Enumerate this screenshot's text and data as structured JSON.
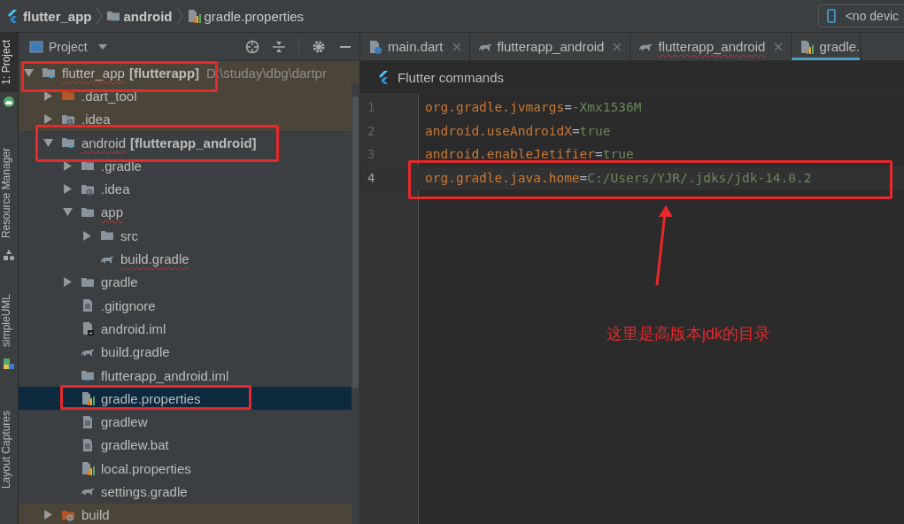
{
  "breadcrumbs": [
    {
      "label": "flutter_app"
    },
    {
      "label": "android"
    },
    {
      "label": "gradle.properties"
    }
  ],
  "device_selector": {
    "label": "<no devic"
  },
  "tool_strip": [
    {
      "label": "1: Project",
      "selected": true
    },
    {
      "label": "Resource Manager",
      "selected": false
    },
    {
      "label": "simpleUML",
      "selected": false
    },
    {
      "label": "Layout Captures",
      "selected": false
    }
  ],
  "project_panel": {
    "title": "Project"
  },
  "tree": [
    {
      "name": "flutter_app",
      "module": "[flutterapp]",
      "path": "D:\\studay\\dbg\\dartpr",
      "kind": "module",
      "expanded": true,
      "typo": true,
      "excluded": true,
      "selected": false,
      "children": [
        {
          "name": ".dart_tool",
          "kind": "orange-folder",
          "expanded": false,
          "typo": false,
          "excluded": true,
          "selected": false
        },
        {
          "name": ".idea",
          "kind": "idea-folder",
          "expanded": false,
          "typo": false,
          "excluded": true,
          "selected": false
        },
        {
          "name": "android",
          "module": "[flutterapp_android]",
          "kind": "module",
          "expanded": true,
          "typo": true,
          "excluded": false,
          "selected": false,
          "children": [
            {
              "name": ".gradle",
              "kind": "folder",
              "expanded": false,
              "typo": false,
              "excluded": false,
              "selected": false
            },
            {
              "name": ".idea",
              "kind": "idea-folder",
              "expanded": false,
              "typo": false,
              "excluded": false,
              "selected": false
            },
            {
              "name": "app",
              "kind": "folder",
              "expanded": true,
              "typo": true,
              "excluded": false,
              "selected": false,
              "children": [
                {
                  "name": "src",
                  "kind": "folder",
                  "expanded": false,
                  "typo": false,
                  "excluded": false,
                  "selected": false
                },
                {
                  "name": "build.gradle",
                  "kind": "gradle",
                  "typo": true,
                  "excluded": false,
                  "selected": false
                }
              ]
            },
            {
              "name": "gradle",
              "kind": "folder",
              "expanded": false,
              "typo": false,
              "excluded": false,
              "selected": false
            },
            {
              "name": ".gitignore",
              "kind": "text",
              "typo": false,
              "excluded": false,
              "selected": false
            },
            {
              "name": "android.iml",
              "kind": "iml",
              "typo": false,
              "excluded": false,
              "selected": false
            },
            {
              "name": "build.gradle",
              "kind": "gradle",
              "typo": false,
              "excluded": false,
              "selected": false
            },
            {
              "name": "flutterapp_android.iml",
              "kind": "module-file",
              "typo": false,
              "excluded": false,
              "selected": false
            },
            {
              "name": "gradle.properties",
              "kind": "properties",
              "typo": false,
              "excluded": false,
              "selected": true
            },
            {
              "name": "gradlew",
              "kind": "text",
              "typo": false,
              "excluded": false,
              "selected": false
            },
            {
              "name": "gradlew.bat",
              "kind": "text",
              "typo": false,
              "excluded": false,
              "selected": false
            },
            {
              "name": "local.properties",
              "kind": "properties",
              "typo": false,
              "excluded": false,
              "selected": false
            },
            {
              "name": "settings.gradle",
              "kind": "gradle",
              "typo": false,
              "excluded": false,
              "selected": false
            }
          ]
        },
        {
          "name": "build",
          "kind": "orange-idea-folder",
          "expanded": false,
          "typo": false,
          "excluded": true,
          "selected": false
        }
      ]
    }
  ],
  "tabs": [
    {
      "label": "main.dart",
      "kind": "dart",
      "selected": false,
      "typo": false
    },
    {
      "label": "flutterapp_android",
      "kind": "gradle",
      "selected": false,
      "typo": false
    },
    {
      "label": "flutterapp_android",
      "kind": "gradle",
      "selected": false,
      "typo": true
    },
    {
      "label": "gradle.",
      "kind": "properties",
      "selected": true,
      "typo": false
    }
  ],
  "flutter_bar": {
    "label": "Flutter commands"
  },
  "code_lines": [
    {
      "number": "1",
      "key": "org.gradle.jvmargs",
      "separator": "=",
      "value": "-Xmx1536M",
      "current": false
    },
    {
      "number": "2",
      "key": "android.useAndroidX",
      "separator": "=",
      "value": "true",
      "current": false
    },
    {
      "number": "3",
      "key": "android.enableJetifier",
      "separator": "=",
      "value": "true",
      "current": false
    },
    {
      "number": "4",
      "key": "org.gradle.java.home",
      "separator": "=",
      "value": "C:/Users/YJR/.jdks/jdk-14.0.2",
      "current": true
    }
  ],
  "annotation": {
    "note": "这里是高版本jdk的目录"
  }
}
